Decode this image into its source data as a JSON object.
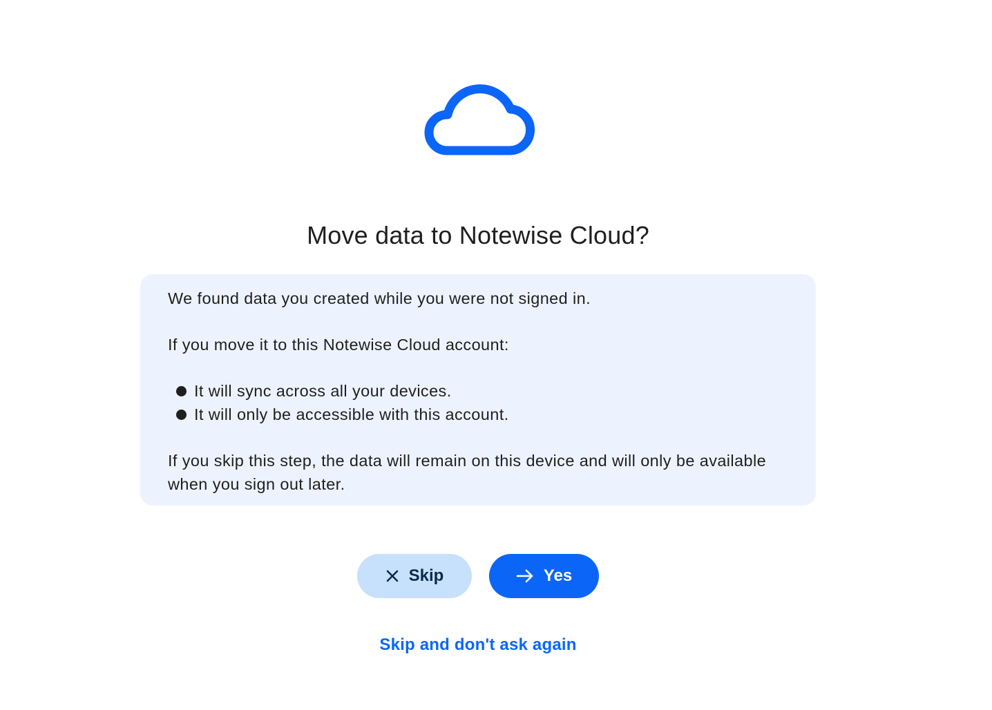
{
  "icon": "cloud-icon",
  "title": "Move data to Notewise Cloud?",
  "info": {
    "intro": "We found data you created while you were not signed in.",
    "lead": "If you move it to this Notewise Cloud account:",
    "bullets": [
      "It will sync across all your devices.",
      "It will only be accessible with this account."
    ],
    "skip_note": "If you skip this step, the data will remain on this device and will only be available when you sign out later."
  },
  "buttons": {
    "skip_label": "Skip",
    "skip_icon": "close-icon",
    "yes_label": "Yes",
    "yes_icon": "arrow-right-icon"
  },
  "link": {
    "dont_ask_label": "Skip and don't ask again"
  },
  "colors": {
    "accent": "#0b66f7",
    "info_background": "#edf3fe",
    "skip_button_background": "#c7e0fc"
  }
}
